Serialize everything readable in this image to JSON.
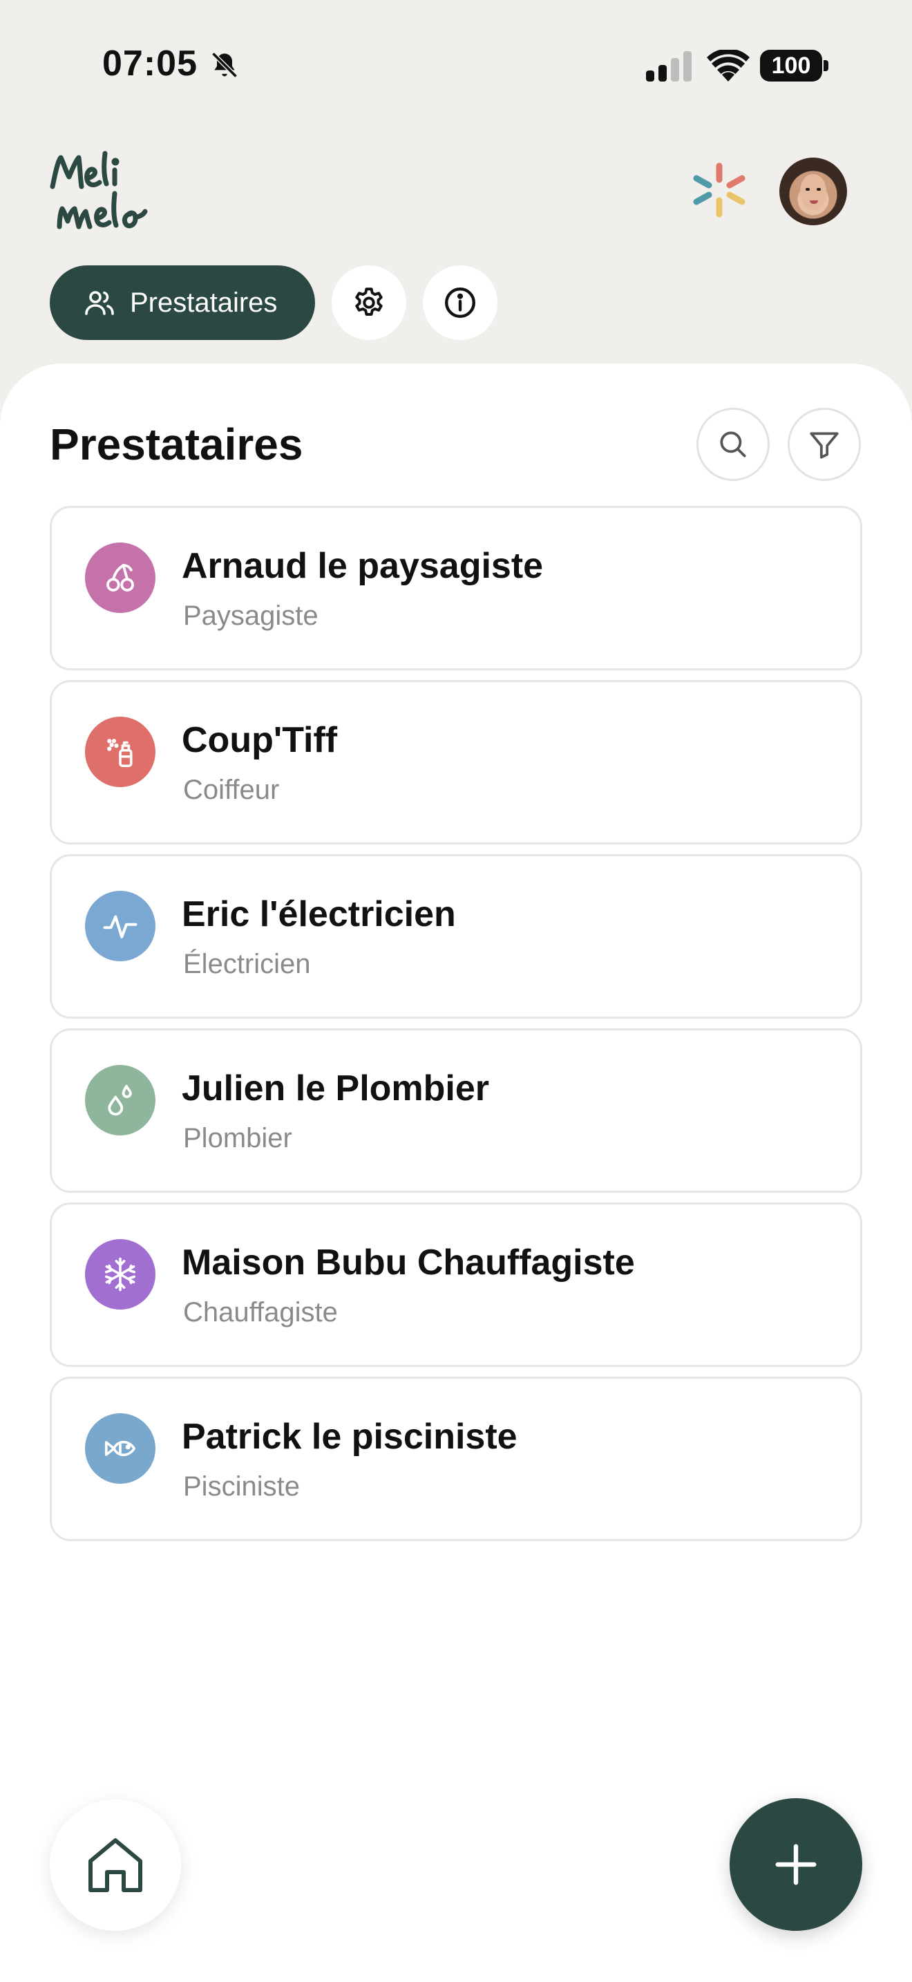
{
  "status_bar": {
    "time": "07:05",
    "battery": "100",
    "icons": [
      "bell-slash-icon",
      "cellular-signal-icon",
      "wifi-icon",
      "battery-icon"
    ]
  },
  "header": {
    "logo_text": "Meli melo",
    "nav_tab_label": "Prestataires",
    "icons": [
      "users-icon",
      "gear-icon",
      "info-icon",
      "sparkle-icon"
    ]
  },
  "main": {
    "title": "Prestataires",
    "actions": [
      "search-icon",
      "filter-icon"
    ],
    "providers": [
      {
        "name": "Arnaud le paysagiste",
        "role": "Paysagiste",
        "icon": "cherry-icon",
        "color": "#c572ab"
      },
      {
        "name": "Coup'Tiff",
        "role": "Coiffeur",
        "icon": "spray-bottle-icon",
        "color": "#de7069"
      },
      {
        "name": "Eric l'électricien",
        "role": "Électricien",
        "icon": "pulse-icon",
        "color": "#7ba8d2"
      },
      {
        "name": "Julien le Plombier",
        "role": "Plombier",
        "icon": "droplets-icon",
        "color": "#8fb59c"
      },
      {
        "name": "Maison Bubu Chauffagiste",
        "role": "Chauffagiste",
        "icon": "snowflake-icon",
        "color": "#a16ed1"
      },
      {
        "name": "Patrick le pisciniste",
        "role": "Pisciniste",
        "icon": "fish-icon",
        "color": "#7aa8cd"
      }
    ]
  },
  "bottom": {
    "icons": [
      "home-icon",
      "plus-icon"
    ]
  },
  "colors": {
    "accent": "#2b4942",
    "background": "#f1efec",
    "card_border": "#e6e6e6",
    "subtitle": "#8a8a8a"
  }
}
